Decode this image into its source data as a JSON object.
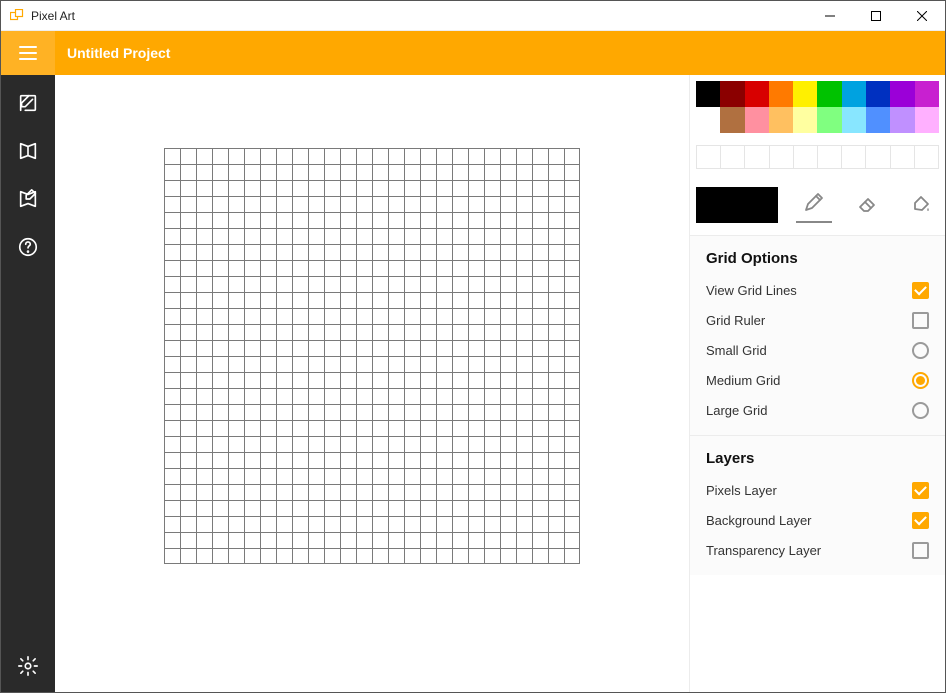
{
  "window": {
    "title": "Pixel Art"
  },
  "header": {
    "project_title": "Untitled Project"
  },
  "palette": {
    "row1": [
      "#000000",
      "#8b0000",
      "#d80000",
      "#ff7a00",
      "#fff000",
      "#00c200",
      "#00a2e0",
      "#0030c0",
      "#9b00d8",
      "#c820d0"
    ],
    "row2": [
      "#ffffff",
      "#b07040",
      "#ff90a0",
      "#ffc060",
      "#ffffa0",
      "#80ff80",
      "#88e6ff",
      "#5090ff",
      "#c090ff",
      "#ffb0ff"
    ],
    "current_color": "#000000",
    "tools": {
      "pencil": "Pencil",
      "eraser": "Eraser",
      "fill": "Fill"
    }
  },
  "grid_options": {
    "heading": "Grid Options",
    "view_grid_lines": {
      "label": "View Grid Lines",
      "checked": true
    },
    "grid_ruler": {
      "label": "Grid Ruler",
      "checked": false
    },
    "small_grid": {
      "label": "Small Grid"
    },
    "medium_grid": {
      "label": "Medium Grid"
    },
    "large_grid": {
      "label": "Large Grid"
    },
    "selected_size": "medium"
  },
  "layers": {
    "heading": "Layers",
    "pixels": {
      "label": "Pixels Layer",
      "checked": true
    },
    "background": {
      "label": "Background Layer",
      "checked": true
    },
    "transparency": {
      "label": "Transparency Layer",
      "checked": false
    }
  }
}
